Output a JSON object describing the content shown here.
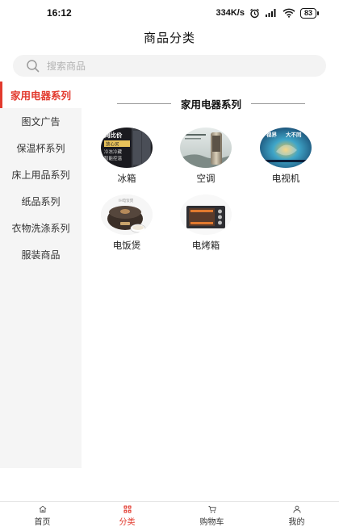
{
  "status_bar": {
    "time": "16:12",
    "network_speed": "334K/s",
    "battery": "83"
  },
  "nav": {
    "title": "商品分类"
  },
  "search": {
    "placeholder": "搜索商品"
  },
  "sidebar": {
    "items": [
      {
        "label": "家用电器系列",
        "active": true
      },
      {
        "label": "图文广告",
        "active": false
      },
      {
        "label": "保温杯系列",
        "active": false
      },
      {
        "label": "床上用品系列",
        "active": false
      },
      {
        "label": "纸品系列",
        "active": false
      },
      {
        "label": "衣物洗涤系列",
        "active": false
      },
      {
        "label": "服装商品",
        "active": false
      }
    ]
  },
  "section": {
    "title": "家用电器系列",
    "products": [
      {
        "name": "冰箱",
        "image_text": [
          "网比价",
          "放心买",
          "冷冻冷藏",
          "智能控温"
        ]
      },
      {
        "name": "空调",
        "image_text": []
      },
      {
        "name": "电视机",
        "image_text": [
          "视界",
          "大不同"
        ]
      },
      {
        "name": "电饭煲",
        "image_text": [
          "IH电饭煲"
        ]
      },
      {
        "name": "电烤箱",
        "image_text": []
      }
    ]
  },
  "tabs": [
    {
      "label": "首页",
      "icon": "home-icon",
      "active": false
    },
    {
      "label": "分类",
      "icon": "category-icon",
      "active": true
    },
    {
      "label": "购物车",
      "icon": "cart-icon",
      "active": false
    },
    {
      "label": "我的",
      "icon": "user-icon",
      "active": false
    }
  ],
  "colors": {
    "accent": "#e23a2e",
    "sidebar_bg": "#f5f5f5",
    "search_bg": "#f3f3f3"
  }
}
